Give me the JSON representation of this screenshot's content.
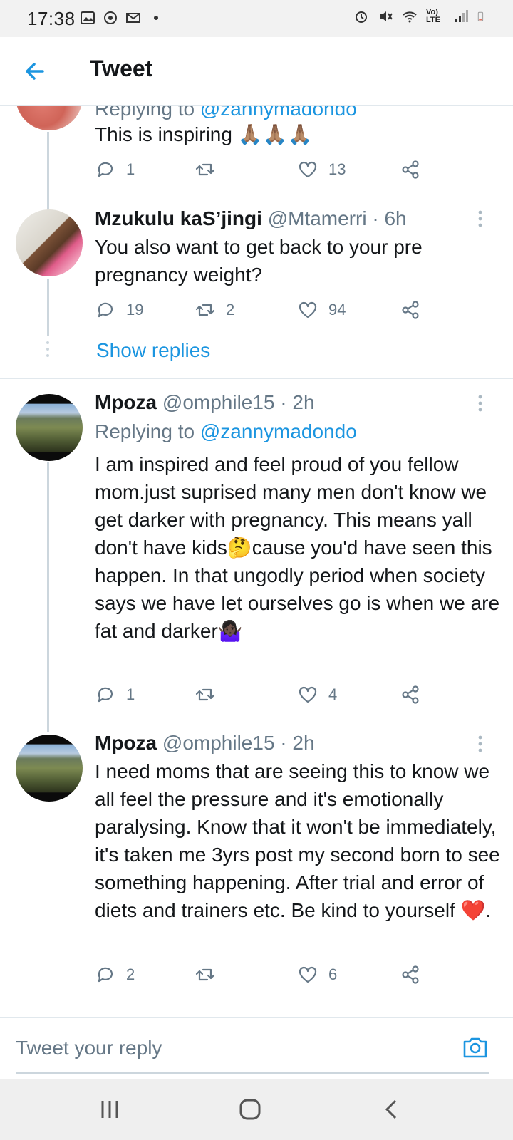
{
  "status_bar": {
    "time": "17:38",
    "network_label": "Vo) LTE"
  },
  "app_bar": {
    "title": "Tweet",
    "back_icon": "arrow-left-icon"
  },
  "tweets": [
    {
      "replying_prefix": "Replying to ",
      "replying_to": "@zannymadondo",
      "text": "This is inspiring 🙏🏽🙏🏽🙏🏽",
      "replies": "1",
      "retweets": "",
      "likes": "13"
    },
    {
      "name": "Mzukulu kaS’jingi",
      "handle": "@Mtamerri",
      "time": "· 6h",
      "text": "You also want to get back to your pre pregnancy weight?",
      "replies": "19",
      "retweets": "2",
      "likes": "94",
      "show_replies": "Show replies"
    },
    {
      "name": "Mpoza",
      "handle": "@omphile15",
      "time": "· 2h",
      "replying_prefix": "Replying to ",
      "replying_to": "@zannymadondo",
      "text": "I am inspired and feel proud of you fellow mom.just suprised many men don't know we get darker with pregnancy. This means yall don't have kids🤔cause you'd have seen this happen. In that ungodly period when society says we have let ourselves go is when we are fat and darker🤷🏿‍♀️",
      "replies": "1",
      "retweets": "",
      "likes": "4"
    },
    {
      "name": "Mpoza",
      "handle": "@omphile15",
      "time": "· 2h",
      "text": "I need moms that are seeing this to know we all feel the pressure and it's emotionally paralysing. Know that it won't be immediately, it's taken me 3yrs post my second born to see something happening. After trial and error of diets and trainers etc. Be kind to yourself ❤️.",
      "replies": "2",
      "retweets": "",
      "likes": "6"
    }
  ],
  "compose": {
    "placeholder": "Tweet your reply",
    "camera_icon": "camera-icon"
  },
  "nav_bar": {
    "icons": [
      "recents-icon",
      "home-icon",
      "back-icon"
    ]
  },
  "colors": {
    "accent": "#1b95e0",
    "text": "#14171a",
    "muted": "#657786",
    "line": "#ccd6dd"
  }
}
